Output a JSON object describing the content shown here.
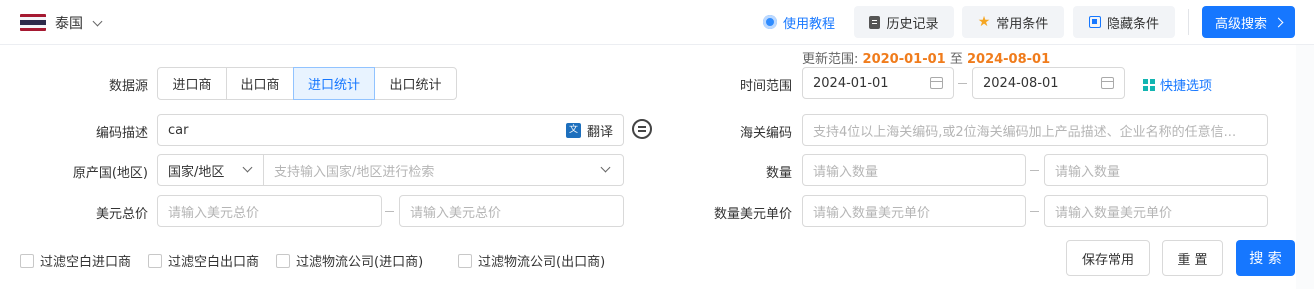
{
  "header": {
    "country": "泰国",
    "flag_colors": [
      "#a51931",
      "#f4f5f8",
      "#2d2a4a",
      "#f4f5f8",
      "#a51931"
    ],
    "tutorial_label": "使用教程",
    "history_label": "历史记录",
    "common_label": "常用条件",
    "hide_label": "隐藏条件",
    "advanced_label": "高级搜索"
  },
  "update_range": {
    "prefix": "更新范围:",
    "start": "2020-01-01",
    "joiner": "至",
    "end": "2024-08-01"
  },
  "data_source": {
    "label": "数据源",
    "options": [
      "进口商",
      "出口商",
      "进口统计",
      "出口统计"
    ],
    "selected": "进口统计"
  },
  "time_range": {
    "label": "时间范围",
    "start": "2024-01-01",
    "end": "2024-08-01",
    "quick_label": "快捷选项"
  },
  "code_desc": {
    "label": "编码描述",
    "value": "car",
    "translate_label": "翻译"
  },
  "hs_code": {
    "label": "海关编码",
    "placeholder": "支持4位以上海关编码,或2位海关编码加上产品描述、企业名称的任意信..."
  },
  "origin": {
    "label": "原产国(地区)",
    "type_value": "国家/地区",
    "placeholder": "支持输入国家/地区进行检索"
  },
  "quantity": {
    "label": "数量",
    "min_placeholder": "请输入数量",
    "max_placeholder": "请输入数量"
  },
  "usd_total": {
    "label": "美元总价",
    "min_placeholder": "请输入美元总价",
    "max_placeholder": "请输入美元总价"
  },
  "usd_unit": {
    "label": "数量美元单价",
    "min_placeholder": "请输入数量美元单价",
    "max_placeholder": "请输入数量美元单价"
  },
  "filters": [
    "过滤空白进口商",
    "过滤空白出口商",
    "过滤物流公司(进口商)",
    "过滤物流公司(出口商)"
  ],
  "actions": {
    "save_label": "保存常用",
    "reset_label": "重 置",
    "search_label": "搜 索"
  },
  "colors": {
    "accent": "#1677ff",
    "highlight": "#f07c1c"
  }
}
